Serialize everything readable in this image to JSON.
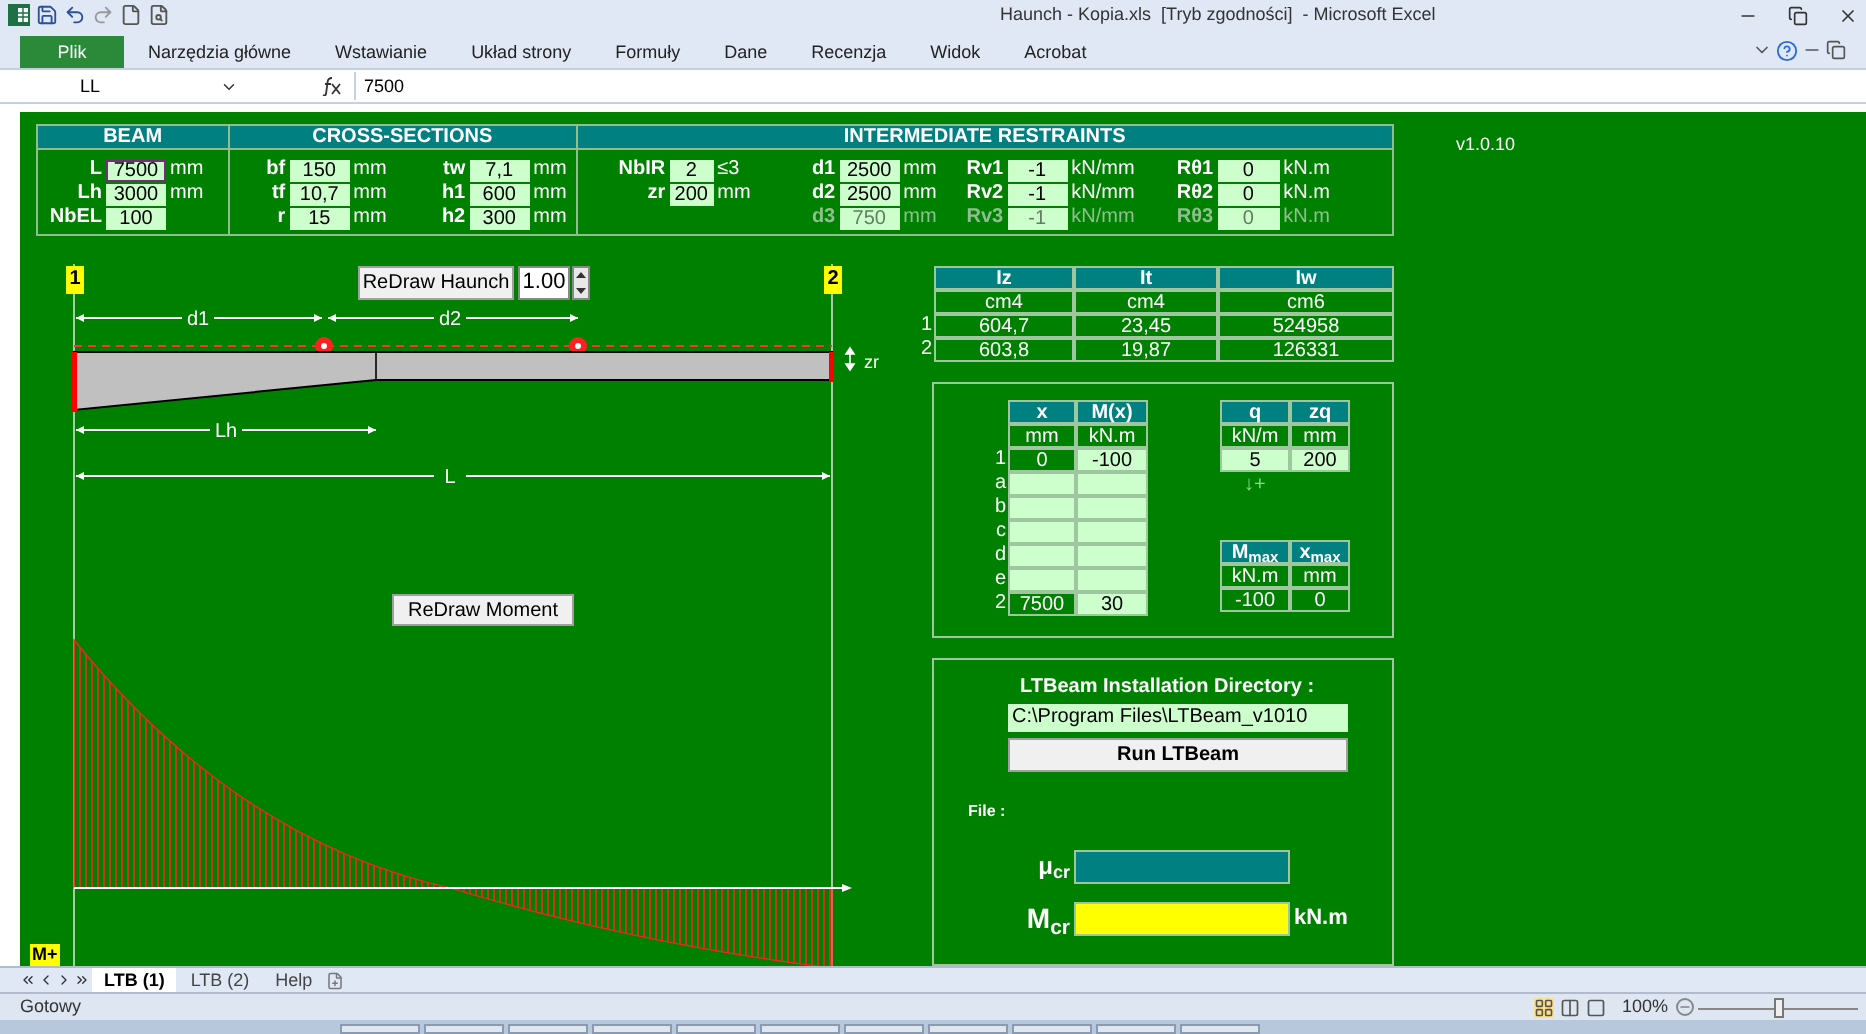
{
  "window": {
    "title": "Haunch - Kopia.xls  [Tryb zgodności]  - Microsoft Excel"
  },
  "ribbon_tabs": [
    {
      "label": "Plik",
      "selected": true
    },
    {
      "label": "Narzędzia główne",
      "selected": false
    },
    {
      "label": "Wstawianie",
      "selected": false
    },
    {
      "label": "Układ strony",
      "selected": false
    },
    {
      "label": "Formuły",
      "selected": false
    },
    {
      "label": "Dane",
      "selected": false
    },
    {
      "label": "Recenzja",
      "selected": false
    },
    {
      "label": "Widok",
      "selected": false
    },
    {
      "label": "Acrobat",
      "selected": false
    }
  ],
  "formula_bar": {
    "name_box": "LL",
    "value": "7500"
  },
  "version": "v1.0.10",
  "sections": [
    {
      "title": "BEAM",
      "columns": [
        [
          {
            "label": "L",
            "value": "7500",
            "unit": "mm",
            "active": true
          },
          {
            "label": "Lh",
            "value": "3000",
            "unit": "mm",
            "active": false
          },
          {
            "label": "NbEL",
            "value": "100",
            "active": false
          }
        ]
      ]
    },
    {
      "title": "CROSS-SECTIONS",
      "columns": [
        [
          {
            "label": "bf",
            "value": "150",
            "unit": "mm"
          },
          {
            "label": "tf",
            "value": "10,7",
            "unit": "mm"
          },
          {
            "label": "r",
            "value": "15",
            "unit": "mm"
          }
        ],
        [
          {
            "label": "tw",
            "value": "7,1",
            "unit": "mm"
          },
          {
            "label": "h1",
            "value": "600",
            "unit": "mm"
          },
          {
            "label": "h2",
            "value": "300",
            "unit": "mm"
          }
        ]
      ]
    },
    {
      "title": "INTERMEDIATE RESTRAINTS",
      "columns": [
        [
          {
            "label": "NbIR",
            "value": "2",
            "unit": "≤3",
            "disabled": false
          },
          {
            "label": "zr",
            "value": "200",
            "unit": "mm",
            "disabled": false
          }
        ],
        [
          {
            "label": "d1",
            "value": "2500",
            "unit": "mm",
            "disabled": false
          },
          {
            "label": "d2",
            "value": "2500",
            "unit": "mm",
            "disabled": false
          },
          {
            "label": "d3",
            "value": "750",
            "unit": "mm",
            "disabled": true
          }
        ],
        [
          {
            "label": "Rv1",
            "value": "-1",
            "unit": "kN/mm",
            "disabled": false
          },
          {
            "label": "Rv2",
            "value": "-1",
            "unit": "kN/mm",
            "disabled": false
          },
          {
            "label": "Rv3",
            "value": "-1",
            "unit": "kN/mm",
            "disabled": true
          }
        ],
        [
          {
            "label": "Rθ1",
            "value": "0",
            "unit": "kN.m",
            "disabled": false
          },
          {
            "label": "Rθ2",
            "value": "0",
            "unit": "kN.m",
            "disabled": false
          },
          {
            "label": "Rθ3",
            "value": "0",
            "unit": "kN.m",
            "disabled": true
          }
        ]
      ]
    }
  ],
  "diagram": {
    "node_1": "1",
    "node_2": "2",
    "redraw_haunch": "ReDraw Haunch",
    "scale": "1.00",
    "d1": "d1",
    "d2": "d2",
    "zr": "zr",
    "lh": "Lh",
    "l": "L",
    "redraw_moment": "ReDraw Moment",
    "moment_label": "M+"
  },
  "section_table": {
    "columns": [
      "Iz",
      "It",
      "Iw"
    ],
    "units": [
      "cm4",
      "cm4",
      "cm6"
    ],
    "rows": [
      {
        "label": "1",
        "cells": [
          {
            "value": "604,7",
            "input": false
          },
          {
            "value": "23,45",
            "input": false
          },
          {
            "value": "524958",
            "input": false
          }
        ]
      },
      {
        "label": "2",
        "cells": [
          {
            "value": "603,8",
            "input": false
          },
          {
            "value": "19,87",
            "input": false
          },
          {
            "value": "126331",
            "input": false
          }
        ]
      }
    ]
  },
  "moment_table": {
    "columns": [
      "x",
      "M(x)"
    ],
    "units": [
      "mm",
      "kN.m"
    ],
    "rows": [
      {
        "label": "1",
        "cells": [
          {
            "value": "0",
            "input": false
          },
          {
            "value": "-100",
            "input": true
          }
        ]
      },
      {
        "label": "a",
        "cells": [
          {
            "input": true
          },
          {
            "input": true
          }
        ]
      },
      {
        "label": "b",
        "cells": [
          {
            "input": true
          },
          {
            "input": true
          }
        ]
      },
      {
        "label": "c",
        "cells": [
          {
            "input": true
          },
          {
            "input": true
          }
        ]
      },
      {
        "label": "d",
        "cells": [
          {
            "input": true
          },
          {
            "input": true
          }
        ]
      },
      {
        "label": "e",
        "cells": [
          {
            "input": true
          },
          {
            "input": true
          }
        ]
      },
      {
        "label": "2",
        "cells": [
          {
            "value": "7500",
            "input": false
          },
          {
            "value": "30",
            "input": true
          }
        ]
      }
    ]
  },
  "load_table": {
    "columns": [
      "q",
      "zq"
    ],
    "units": [
      "kN/m",
      "mm"
    ],
    "rows": [
      {
        "cells": [
          {
            "value": "5",
            "input": true
          },
          {
            "value": "200",
            "input": true
          }
        ]
      }
    ]
  },
  "load_direction": "↓+",
  "max_table": {
    "columns": [
      "M$_{max}$",
      "x$_{max}$"
    ],
    "units": [
      "kN.m",
      "mm"
    ],
    "rows": [
      {
        "cells": [
          {
            "value": "-100",
            "input": false
          },
          {
            "value": "0",
            "input": false
          }
        ]
      }
    ]
  },
  "ltbeam": {
    "title": "LTBeam Installation Directory :",
    "path": "C:\\Program Files\\LTBeam_v1010",
    "run": "Run LTBeam",
    "file_label": "File :",
    "mu_label": "μ$_{cr}$",
    "mcr_label": "M$_{cr}$",
    "mcr_unit": "kN.m"
  },
  "sheet_tabs": [
    {
      "label": "LTB (1)",
      "selected": true
    },
    {
      "label": "LTB (2)",
      "selected": false
    },
    {
      "label": "Help",
      "selected": false
    }
  ],
  "status": {
    "text": "Gotowy",
    "zoom": "100%",
    "level": 0.5
  }
}
